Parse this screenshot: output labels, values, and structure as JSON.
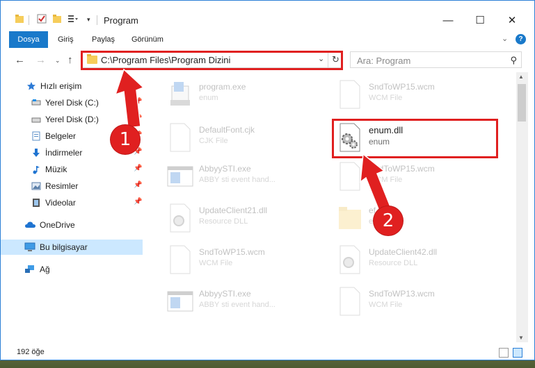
{
  "window": {
    "title": "Program",
    "controls": {
      "minimize": "—",
      "maximize": "☐",
      "close": "✕"
    }
  },
  "ribbon": {
    "tabs": [
      {
        "label": "Dosya",
        "active": true
      },
      {
        "label": "Giriş"
      },
      {
        "label": "Paylaş"
      },
      {
        "label": "Görünüm"
      }
    ],
    "expand_icon": "chevron-down-icon",
    "help": "?"
  },
  "navigation": {
    "address": "C:\\Program Files\\Program Dizini",
    "search_placeholder": "Ara: Program"
  },
  "sidebar": {
    "items": [
      {
        "label": "Hızlı erişim",
        "icon": "star-icon",
        "pinned": false
      },
      {
        "label": "Yerel Disk (C:)",
        "icon": "drive-icon",
        "pinned": true
      },
      {
        "label": "Yerel Disk (D:)",
        "icon": "drive-icon",
        "pinned": true
      },
      {
        "label": "Belgeler",
        "icon": "document-icon",
        "pinned": true
      },
      {
        "label": "İndirmeler",
        "icon": "download-icon",
        "pinned": true
      },
      {
        "label": "Müzik",
        "icon": "music-icon",
        "pinned": true
      },
      {
        "label": "Resimler",
        "icon": "pictures-icon",
        "pinned": true
      },
      {
        "label": "Videolar",
        "icon": "video-icon",
        "pinned": true
      },
      {
        "label": "OneDrive",
        "icon": "cloud-icon"
      },
      {
        "label": "Bu bilgisayar",
        "icon": "computer-icon",
        "selected": true
      },
      {
        "label": "Ağ",
        "icon": "network-icon"
      }
    ]
  },
  "files": [
    {
      "name": "program.exe",
      "type": "enum",
      "icon": "installer-icon"
    },
    {
      "name": "SndToWP15.wcm",
      "type": "WCM File",
      "icon": "blank-file-icon"
    },
    {
      "name": "DefaultFont.cjk",
      "type": "CJK File",
      "icon": "blank-file-icon"
    },
    {
      "name": "enum.dll",
      "type": "enum",
      "icon": "dll-gear-icon",
      "highlighted": true
    },
    {
      "name": "AbbyySTI.exe",
      "type": "ABBY sti event hand...",
      "icon": "app-window-icon"
    },
    {
      "name": "SndToWP15.wcm",
      "type": "WCM File",
      "icon": "blank-file-icon"
    },
    {
      "name": "UpdateClient21.dll",
      "type": "Resource DLL",
      "icon": "dll-gear-icon"
    },
    {
      "name": "ef",
      "type": "ef",
      "icon": "folder-icon"
    },
    {
      "name": "SndToWP15.wcm",
      "type": "WCM File",
      "icon": "blank-file-icon"
    },
    {
      "name": "UpdateClient42.dll",
      "type": "Resource DLL",
      "icon": "dll-gear-icon"
    },
    {
      "name": "AbbyySTI.exe",
      "type": "ABBY sti event hand...",
      "icon": "app-window-icon"
    },
    {
      "name": "SndToWP13.wcm",
      "type": "WCM File",
      "icon": "blank-file-icon"
    }
  ],
  "status": {
    "item_count": "192 öğe"
  },
  "annotations": {
    "callout_1": "1",
    "callout_2": "2",
    "color": "#e02020"
  }
}
